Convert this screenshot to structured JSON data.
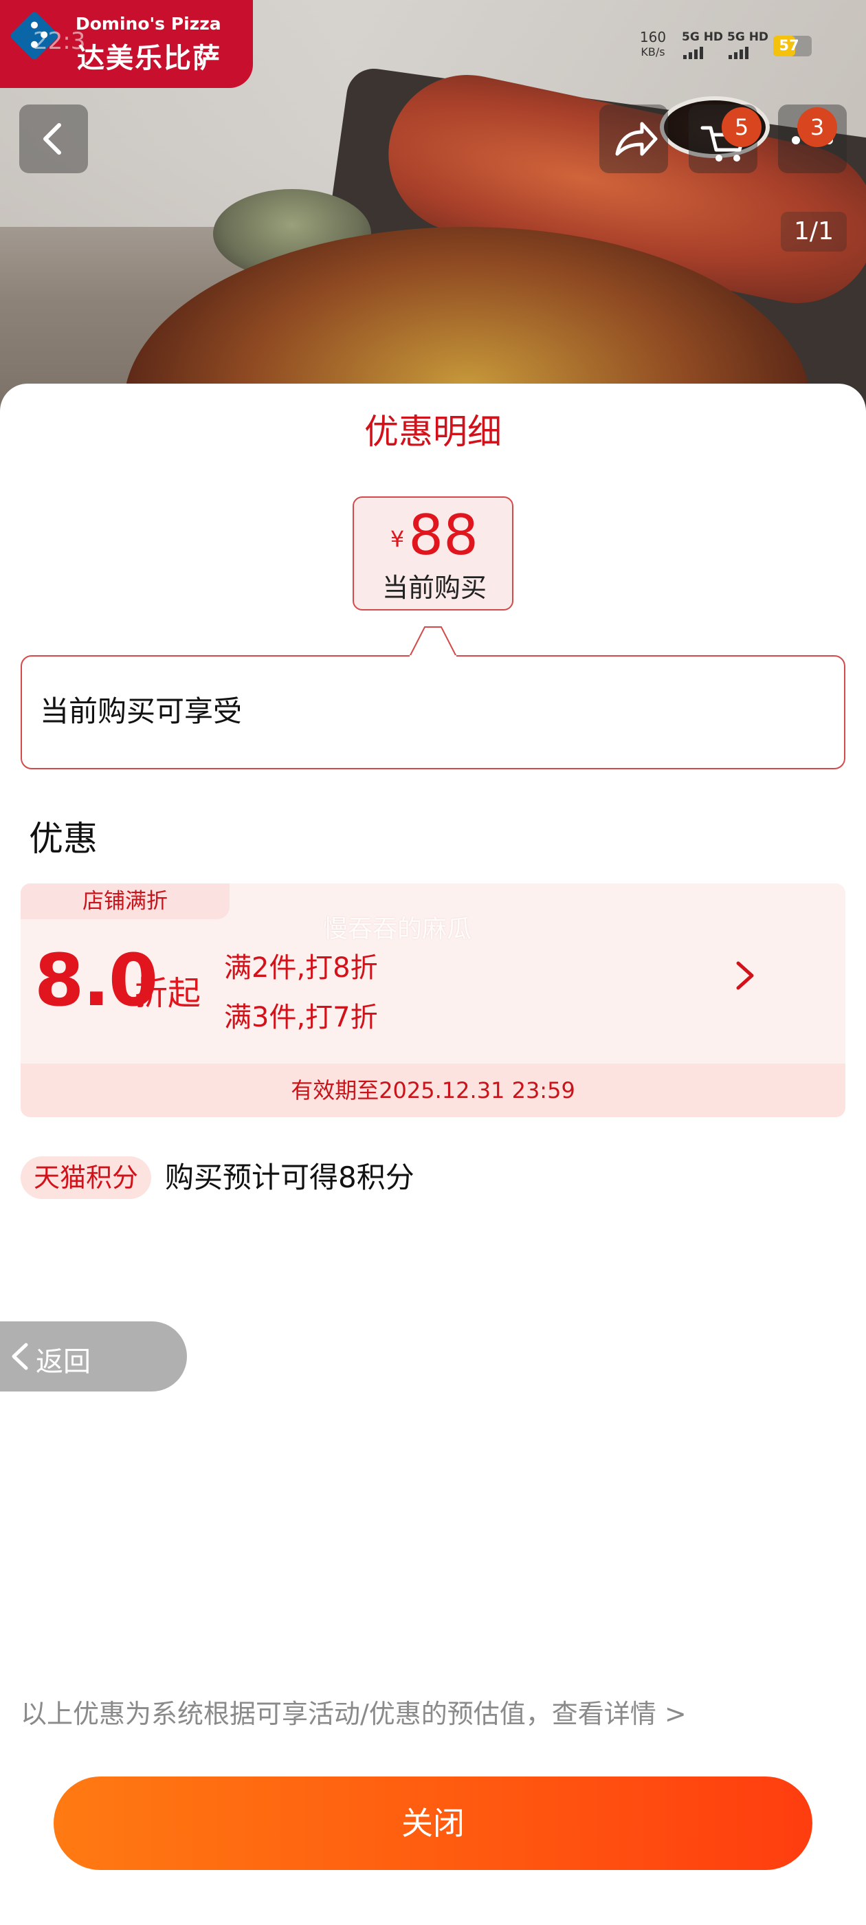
{
  "brand": {
    "name_en": "Domino's Pizza",
    "name_cn": "达美乐比萨",
    "clock": "22:3"
  },
  "status_bar": {
    "speed_value": "160",
    "speed_unit": "KB/s",
    "sig1": "5G HD",
    "sig2": "5G HD",
    "battery": "57",
    "battery_level_pct": 57,
    "battery_color": "#f4c20d"
  },
  "header": {
    "cart_badge": "5",
    "more_badge": "3",
    "pager": "1/1"
  },
  "icons": {
    "back": "chevron-left-icon",
    "share": "share-icon",
    "cart": "cart-icon",
    "more": "more-icon",
    "detail": "chevron-right-icon"
  },
  "sheet": {
    "title": "优惠明细",
    "price": {
      "currency": "¥",
      "amount": "88",
      "label": "当前购买"
    },
    "callout_text": "当前购买可享受",
    "section_title": "优惠",
    "coupon": {
      "tag": "店铺满折",
      "discount": "8.0",
      "discount_suffix": "折起",
      "rules": [
        "满2件,打8折",
        "满3件,打7折"
      ],
      "validity": "有效期至2025.12.31 23:59"
    },
    "watermark": "慢吞吞的麻瓜",
    "points": {
      "tag": "天猫积分",
      "text": "购买预计可得8积分"
    },
    "float_back": "返回",
    "disclaimer": "以上优惠为系统根据可享活动/优惠的预估值，查看详情 >",
    "close_button": "关闭"
  },
  "colors": {
    "accent_red": "#e0151d",
    "brand_red": "#c8102e",
    "close_gradient_start": "#ff7a12",
    "close_gradient_end": "#ff3d0f"
  }
}
